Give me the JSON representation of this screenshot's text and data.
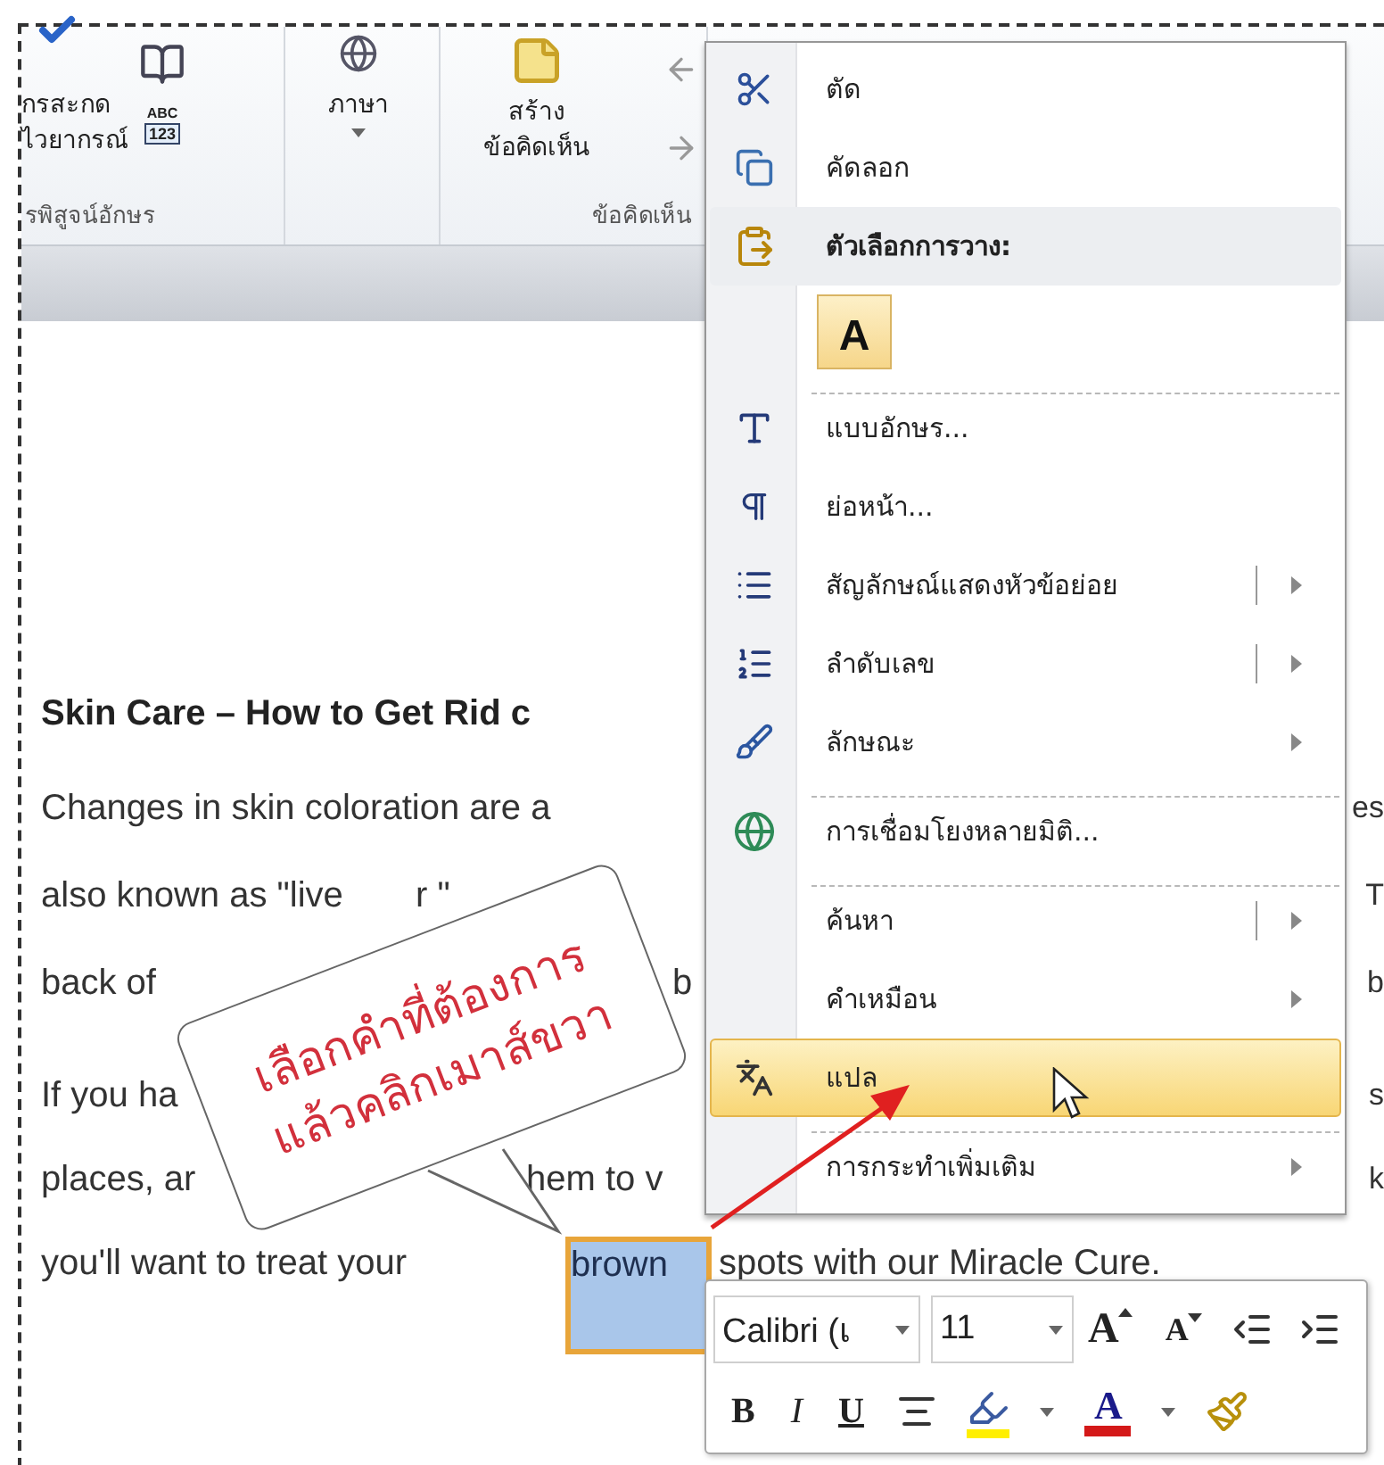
{
  "ribbon": {
    "groups": [
      {
        "kind": "proofing",
        "button": [
          "กรสะกด",
          "ไวยากรณ์"
        ],
        "badge": [
          "ABC",
          "123"
        ],
        "label": "รพิสูจน์อักษร"
      },
      {
        "kind": "language",
        "button": [
          "ภาษา"
        ]
      },
      {
        "kind": "comments",
        "button": [
          "สร้าง",
          "ข้อคิดเห็น"
        ],
        "label": "ข้อคิดเห็น"
      }
    ]
  },
  "document": {
    "heading": "Skin Care – How to Get Rid c",
    "paragraphs": [
      {
        "lines": [
          {
            "segments": [
              {
                "text": "Changes in skin coloration are a",
                "selected": false
              }
            ],
            "edge": "es"
          },
          {
            "segments": [
              {
                "text": "also known as \"live",
                "selected": false
              },
              {
                "text": "r \"",
                "selected": false
              }
            ],
            "edge": "T"
          },
          {
            "segments": [
              {
                "text": "back of",
                "selected": false
              },
              {
                "text": "b",
                "selected": false
              }
            ],
            "edge": "b"
          }
        ]
      },
      {
        "lines": [
          {
            "segments": [
              {
                "text": "If you ha",
                "selected": false
              }
            ],
            "edge": "s"
          },
          {
            "segments": [
              {
                "text": "places, ar",
                "selected": false
              },
              {
                "text": "hem to v",
                "selected": false
              }
            ],
            "edge": "k"
          },
          {
            "segments": [
              {
                "text": "you'll want to treat your",
                "selected": false
              },
              {
                "text": "brown",
                "selected": true
              },
              {
                "text": "spots with our Miracle Cure.",
                "selected": false
              }
            ]
          }
        ]
      }
    ]
  },
  "context_menu": {
    "items": [
      {
        "kind": "item",
        "label": "ตัด",
        "selected": false,
        "separator_before": false,
        "submenu": false,
        "split": false
      },
      {
        "kind": "item",
        "label": "คัดลอก",
        "selected": false,
        "separator_before": false,
        "submenu": false,
        "split": false
      },
      {
        "kind": "header",
        "label": "ตัวเลือกการวาง:",
        "selected": false
      },
      {
        "kind": "paste",
        "label": "A",
        "selected": false
      },
      {
        "kind": "item",
        "label": "แบบอักษร...",
        "selected": false,
        "separator_before": true,
        "submenu": false,
        "split": false
      },
      {
        "kind": "item",
        "label": "ย่อหน้า...",
        "selected": false,
        "separator_before": false,
        "submenu": false,
        "split": false
      },
      {
        "kind": "item",
        "label": "สัญลักษณ์แสดงหัวข้อย่อย",
        "selected": false,
        "separator_before": false,
        "submenu": true,
        "split": true
      },
      {
        "kind": "item",
        "label": "ลำดับเลข",
        "selected": false,
        "separator_before": false,
        "submenu": true,
        "split": true
      },
      {
        "kind": "item",
        "label": "ลักษณะ",
        "selected": false,
        "separator_before": false,
        "submenu": true,
        "split": false
      },
      {
        "kind": "item",
        "label": "การเชื่อมโยงหลายมิติ...",
        "selected": false,
        "separator_before": true,
        "submenu": false,
        "split": false
      },
      {
        "kind": "item",
        "label": "ค้นหา",
        "selected": false,
        "separator_before": true,
        "submenu": true,
        "split": true
      },
      {
        "kind": "item",
        "label": "คำเหมือน",
        "selected": false,
        "separator_before": false,
        "submenu": true,
        "split": false
      },
      {
        "kind": "item",
        "label": "แปล",
        "selected": true,
        "separator_before": false,
        "submenu": false,
        "split": false
      },
      {
        "kind": "item",
        "label": "การกระทำเพิ่มเติม",
        "selected": false,
        "separator_before": true,
        "submenu": true,
        "split": false
      }
    ]
  },
  "mini_toolbar": {
    "font": "Calibri (เ",
    "size": "11",
    "row1": [
      {
        "kind": "grow",
        "label": "A"
      },
      {
        "kind": "shrink",
        "label": "A"
      },
      {
        "kind": "outdent"
      },
      {
        "kind": "indent"
      }
    ],
    "row2": [
      {
        "kind": "bold",
        "label": "B"
      },
      {
        "kind": "italic",
        "label": "I"
      },
      {
        "kind": "underline",
        "label": "U"
      },
      {
        "kind": "center"
      },
      {
        "kind": "highlight"
      },
      {
        "kind": "dropdown"
      },
      {
        "kind": "fontcolor",
        "label": "A"
      },
      {
        "kind": "dropdown"
      },
      {
        "kind": "painter"
      }
    ]
  },
  "callout": {
    "lines": [
      "เลือกคำที่ต้องการ",
      "แล้วคลิกเมาส์ขวา"
    ]
  }
}
